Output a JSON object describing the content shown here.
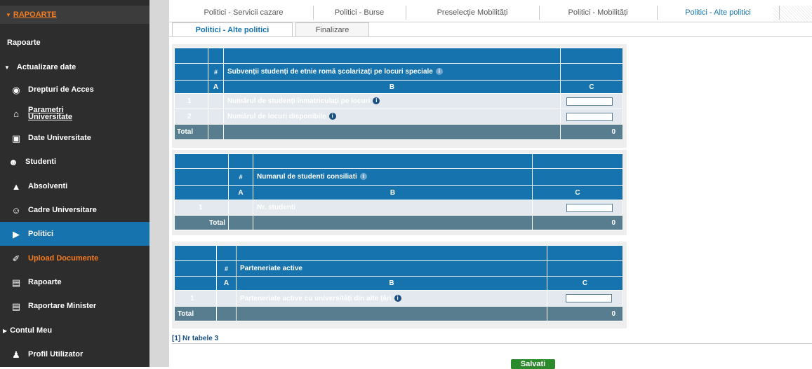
{
  "sidebar": {
    "header": "RAPOARTE",
    "items": [
      {
        "label": "Rapoarte",
        "icon": "none"
      },
      {
        "label": "Actualizare date",
        "icon": "triangle-down-icon"
      },
      {
        "label": "Drepturi de Acces",
        "icon": "users-icon"
      },
      {
        "label": "Parametri Universitate",
        "icon": "building-icon"
      },
      {
        "label": "Date Universitate",
        "icon": "car-icon"
      },
      {
        "label": "Studenti",
        "icon": "students-icon"
      },
      {
        "label": "Absolventi",
        "icon": "graduation-cap-icon"
      },
      {
        "label": "Cadre Universitare",
        "icon": "teacher-icon"
      },
      {
        "label": "Politici",
        "icon": "policy-icon"
      },
      {
        "label": "Upload Documente",
        "icon": "upload-icon"
      },
      {
        "label": "Rapoarte",
        "icon": "chart-icon"
      },
      {
        "label": "Raportare Minister",
        "icon": "chart-icon"
      },
      {
        "label": "Contul Meu",
        "icon": "triangle-right-icon"
      },
      {
        "label": "Profil Utilizator",
        "icon": "user-icon"
      }
    ]
  },
  "tabs_top": [
    "Politici - Servicii cazare",
    "Politici - Burse",
    "Preselecție Mobilități",
    "Politici - Mobilități",
    "Politici - Alte politici"
  ],
  "tabs_sub": [
    "Politici - Alte politici",
    "Finalizare"
  ],
  "tables": [
    {
      "hash": "#",
      "title": "Subvenții studenți de etnie romă școlarizați pe locuri speciale",
      "col_a": "A",
      "col_b": "B",
      "col_c": "C",
      "rows": [
        {
          "num": "1",
          "label": "Numărul de studenți înmatriculați pe locuri"
        },
        {
          "num": "2",
          "label": "Numărul de locuri disponibile"
        }
      ],
      "total_label": "Total",
      "total_value": "0"
    },
    {
      "hash": "#",
      "title": "Numarul de studenti consiliati",
      "col_a": "A",
      "col_b": "B",
      "col_c": "C",
      "rows": [
        {
          "num": "1",
          "label": "Nr. studenti"
        }
      ],
      "total_label": "Total",
      "total_value": "0"
    },
    {
      "hash": "#",
      "title": "Parteneriate active",
      "col_a": "A",
      "col_b": "B",
      "col_c": "C",
      "rows": [
        {
          "num": "1",
          "label": "Parteneriate active cu universități din alte țări"
        }
      ],
      "total_label": "Total",
      "total_value": "0"
    }
  ],
  "footer": {
    "nr_tabele": "[1] Nr tabele 3",
    "save_label": "Salvati"
  },
  "colors": {
    "sidebar_bg": "#2d2d2d",
    "accent_blue": "#1673ad",
    "accent_orange": "#f47c20",
    "total_row": "#577d8e",
    "save_green": "#2b8a2b"
  }
}
